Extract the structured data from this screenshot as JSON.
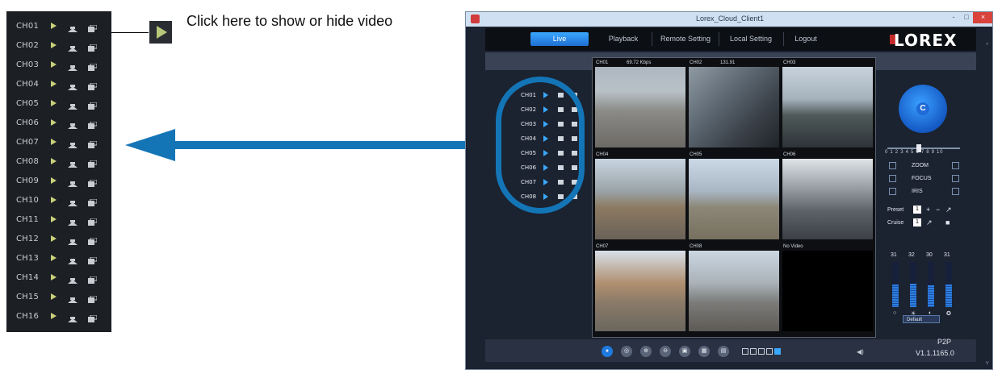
{
  "callout": {
    "text": "Click here to show or hide video"
  },
  "zoom_channels": [
    "CH01",
    "CH02",
    "CH03",
    "CH04",
    "CH05",
    "CH06",
    "CH07",
    "CH08",
    "CH09",
    "CH10",
    "CH11",
    "CH12",
    "CH13",
    "CH14",
    "CH15",
    "CH16"
  ],
  "window": {
    "title": "Lorex_Cloud_Client1",
    "titlebar_buttons": {
      "minimize": "-",
      "maximize": "□",
      "close": "×"
    },
    "nav": {
      "live": "Live",
      "playback": "Playback",
      "remote_setting": "Remote Setting",
      "local_setting": "Local Setting",
      "logout": "Logout"
    },
    "logo": "LOREX",
    "channels": [
      "CH01",
      "CH02",
      "CH03",
      "CH04",
      "CH05",
      "CH06",
      "CH07",
      "CH08"
    ],
    "grid": {
      "cells": [
        {
          "name": "CH01",
          "info": "69.72 Kbps"
        },
        {
          "name": "CH02",
          "info": "131.91"
        },
        {
          "name": "CH03",
          "info": ""
        },
        {
          "name": "CH04",
          "info": ""
        },
        {
          "name": "CH05",
          "info": ""
        },
        {
          "name": "CH06",
          "info": ""
        },
        {
          "name": "CH07",
          "info": ""
        },
        {
          "name": "CH08",
          "info": ""
        },
        {
          "name": "No Video",
          "info": ""
        }
      ]
    },
    "ptz": {
      "center": "C",
      "scale": "0 1 2 3 4 5 6 7 8 9 10",
      "zoom": "ZOOM",
      "focus": "FOCUS",
      "iris": "IRIS",
      "preset_label": "Preset",
      "preset_value": "1",
      "cruise_label": "Cruise",
      "cruise_value": "1",
      "levels": [
        "31",
        "32",
        "30",
        "31"
      ],
      "default_btn": "Default"
    },
    "status": {
      "p2p": "P2P",
      "version": "V1.1.1165.0"
    }
  },
  "colors": {
    "accent": "#1475b6",
    "window_bg": "#1b2230",
    "nav_active": "#1f6fd1"
  }
}
